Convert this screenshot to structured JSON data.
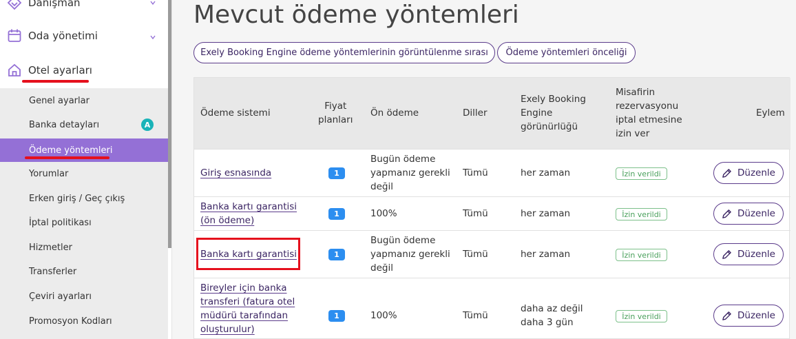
{
  "sidebar": {
    "top_items": [
      {
        "label": "Danışman",
        "icon": "diamond-icon"
      },
      {
        "label": "Oda yönetimi",
        "icon": "calendar-icon"
      },
      {
        "label": "Otel ayarları",
        "icon": "home-icon"
      }
    ],
    "sub_items": [
      {
        "label": "Genel ayarlar"
      },
      {
        "label": "Banka detayları",
        "badge": "A"
      },
      {
        "label": "Ödeme yöntemleri",
        "active": true
      },
      {
        "label": "Yorumlar"
      },
      {
        "label": "Erken giriş / Geç çıkış"
      },
      {
        "label": "İptal politikası"
      },
      {
        "label": "Hizmetler"
      },
      {
        "label": "Transferler"
      },
      {
        "label": "Çeviri ayarları"
      },
      {
        "label": "Promosyon Kodları"
      }
    ]
  },
  "main": {
    "title": "Mevcut ödeme yöntemleri",
    "buttons": [
      {
        "label": "Exely Booking Engine ödeme yöntemlerinin görüntülenme sırası"
      },
      {
        "label": "Ödeme yöntemleri önceliği"
      }
    ]
  },
  "table": {
    "headers": {
      "system": "Ödeme sistemi",
      "plans_1": "Fiyat",
      "plans_2": "planları",
      "prepay": "Ön ödeme",
      "langs": "Diller",
      "vis_1": "Exely Booking",
      "vis_2": "Engine",
      "vis_3": "görünürlüğü",
      "cancel_1": "Misafirin",
      "cancel_2": "rezervasyonu",
      "cancel_3": "iptal etmesine",
      "cancel_4": "izin ver",
      "action": "Eylem"
    },
    "rows": [
      {
        "name_lines": [
          "Giriş esnasında"
        ],
        "plans": "1",
        "prepay_lines": [
          "Bugün ödeme",
          "yapmanız gerekli",
          "değil"
        ],
        "langs": "Tümü",
        "visibility_lines": [
          "her zaman"
        ],
        "status": "İzin verildi",
        "action": "Düzenle"
      },
      {
        "name_lines": [
          "Banka kartı garantisi",
          "(ön ödeme)"
        ],
        "plans": "1",
        "prepay_lines": [
          "100%"
        ],
        "langs": "Tümü",
        "visibility_lines": [
          "her zaman"
        ],
        "status": "İzin verildi",
        "action": "Düzenle"
      },
      {
        "name_lines": [
          "Banka kartı garantisi"
        ],
        "plans": "1",
        "prepay_lines": [
          "Bugün ödeme",
          "yapmanız gerekli",
          "değil"
        ],
        "langs": "Tümü",
        "visibility_lines": [
          "her zaman"
        ],
        "status": "İzin verildi",
        "action": "Düzenle"
      },
      {
        "name_lines": [
          "Bireyler için banka",
          "transferi (fatura otel",
          "müdürü tarafından",
          "oluşturulur)"
        ],
        "plans": "1",
        "prepay_lines": [
          "100%"
        ],
        "langs": "Tümü",
        "visibility_lines": [
          "daha az değil",
          "daha 3 gün"
        ],
        "status": "İzin verildi",
        "action": "Düzenle"
      }
    ]
  },
  "colors": {
    "accent": "#9470d6",
    "link": "#3b2563",
    "highlight": "#e5101d",
    "badge": "#2c8ef0",
    "status": "#4aa05c"
  }
}
